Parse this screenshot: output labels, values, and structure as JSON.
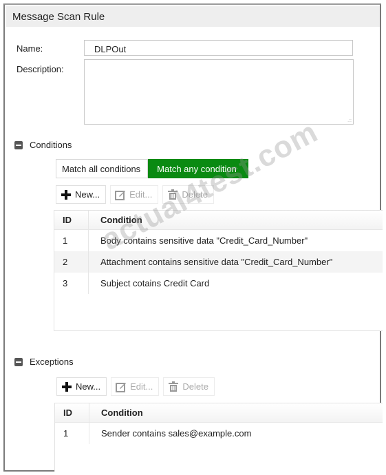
{
  "window": {
    "title": "Message Scan Rule"
  },
  "form": {
    "name_label": "Name:",
    "name_value": "DLPOut",
    "description_label": "Description:",
    "description_value": ""
  },
  "conditions": {
    "heading": "Conditions",
    "match_options": [
      {
        "label": "Match all conditions",
        "selected": false
      },
      {
        "label": "Match any condition",
        "selected": true
      }
    ],
    "accent_color": "#0a8a12",
    "toolbar": {
      "new_label": "New...",
      "edit_label": "Edit...",
      "delete_label": "Delete"
    },
    "columns": [
      "ID",
      "Condition"
    ],
    "rows": [
      {
        "id": "1",
        "condition": "Body contains sensitive data \"Credit_Card_Number\""
      },
      {
        "id": "2",
        "condition": "Attachment contains sensitive data \"Credit_Card_Number\""
      },
      {
        "id": "3",
        "condition": "Subject cotains Credit Card"
      }
    ]
  },
  "exceptions": {
    "heading": "Exceptions",
    "toolbar": {
      "new_label": "New...",
      "edit_label": "Edit...",
      "delete_label": "Delete"
    },
    "columns": [
      "ID",
      "Condition"
    ],
    "rows": [
      {
        "id": "1",
        "condition": "Sender contains sales@example.com"
      }
    ]
  },
  "watermark": "actual4test.com"
}
